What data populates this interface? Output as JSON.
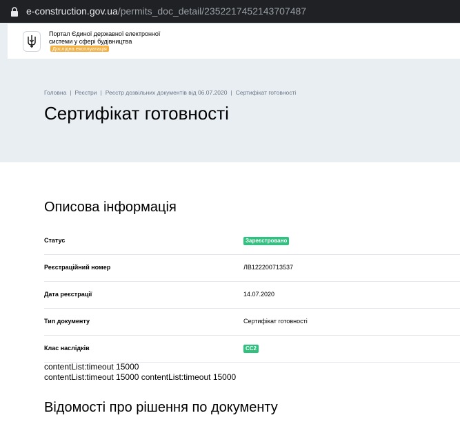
{
  "browser": {
    "url_host": "e-construction.gov.ua",
    "url_path": "/permits_doc_detail/2352217452143707487"
  },
  "header": {
    "portal_name": "Портал Єдиної державної електронної системи у сфері будівництва",
    "trial_badge": "Дослідна експлуатація",
    "emblem_icon": "trident-icon"
  },
  "breadcrumb": [
    {
      "label": "Головна"
    },
    {
      "label": "Реєстри"
    },
    {
      "label": "Реєстр дозвільних документів від 06.07.2020"
    },
    {
      "label": "Сертифікат готовності"
    }
  ],
  "page_title": "Сертифікат готовності",
  "descriptive_section": {
    "title": "Описова інформація",
    "rows": [
      {
        "label": "Статус",
        "value": "Зареєстровано",
        "type": "badge"
      },
      {
        "label": "Реєстраційний номер",
        "value": "ЛВ122200713537",
        "type": "text"
      },
      {
        "label": "Дата реєстрації",
        "value": "14.07.2020",
        "type": "text"
      },
      {
        "label": "Тип документу",
        "value": "Сертифікат готовності",
        "type": "text"
      },
      {
        "label": "Клас наслідків",
        "value": "СС2",
        "type": "badge"
      }
    ]
  },
  "debug_lines": [
    "contentList:timeout 15000",
    "contentList:timeout 15000 contentList:timeout 15000"
  ],
  "decision_section": {
    "title": "Відомості про рішення по документу"
  },
  "colors": {
    "badge_green": "#2ec27e",
    "trial_orange": "#f5b042",
    "top_bg": "#e9eef3"
  }
}
